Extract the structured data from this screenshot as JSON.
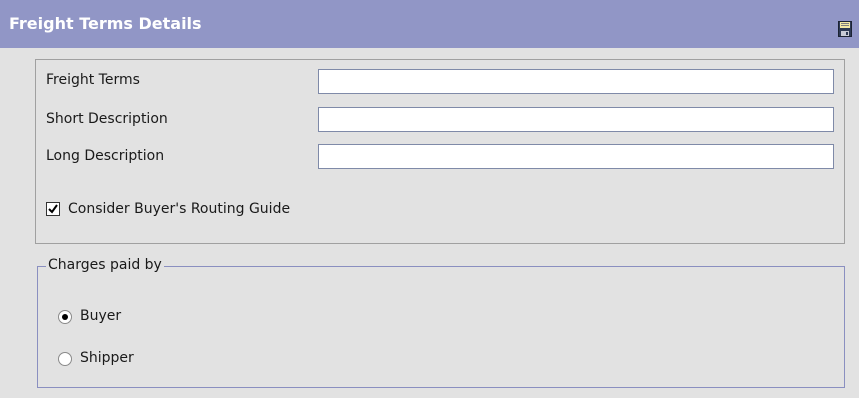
{
  "header": {
    "title": "Freight Terms Details",
    "save_icon": "save-icon"
  },
  "fields": [
    {
      "label": "Freight Terms",
      "value": ""
    },
    {
      "label": "Short Description",
      "value": ""
    },
    {
      "label": "Long Description",
      "value": ""
    }
  ],
  "checkbox": {
    "label": "Consider Buyer's Routing Guide",
    "checked": true
  },
  "charges_paid_by": {
    "legend": "Charges paid by",
    "options": [
      {
        "label": "Buyer",
        "selected": true
      },
      {
        "label": "Shipper",
        "selected": false
      }
    ]
  },
  "colors": {
    "header_bg": "#9196c6",
    "panel_bg": "#e2e2e2",
    "fieldset_border": "#8a8fc0"
  }
}
